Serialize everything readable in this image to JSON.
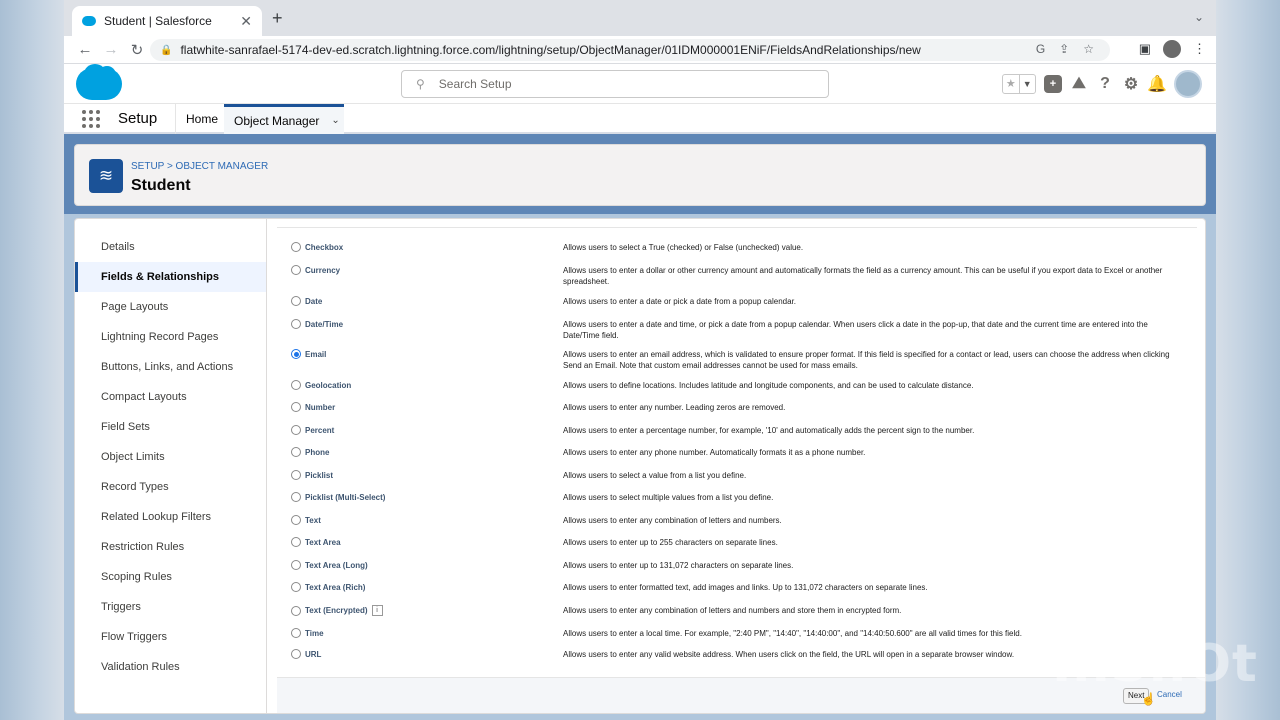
{
  "browser": {
    "tab_title": "Student | Salesforce",
    "tab_close": "✕",
    "new_tab": "+",
    "url": "flatwhite-sanrafael-5174-dev-ed.scratch.lightning.force.com/lightning/setup/ObjectManager/01IDM000001ENiF/FieldsAndRelationships/new"
  },
  "sf_header": {
    "search_placeholder": "Search Setup"
  },
  "setup_nav": {
    "app_name": "Setup",
    "home": "Home",
    "object_manager": "Object Manager"
  },
  "page_header": {
    "breadcrumb": "SETUP > OBJECT MANAGER",
    "title": "Student"
  },
  "sidebar": {
    "items": [
      {
        "label": "Details"
      },
      {
        "label": "Fields & Relationships",
        "active": true
      },
      {
        "label": "Page Layouts"
      },
      {
        "label": "Lightning Record Pages"
      },
      {
        "label": "Buttons, Links, and Actions"
      },
      {
        "label": "Compact Layouts"
      },
      {
        "label": "Field Sets"
      },
      {
        "label": "Object Limits"
      },
      {
        "label": "Record Types"
      },
      {
        "label": "Related Lookup Filters"
      },
      {
        "label": "Restriction Rules"
      },
      {
        "label": "Scoping Rules"
      },
      {
        "label": "Triggers"
      },
      {
        "label": "Flow Triggers"
      },
      {
        "label": "Validation Rules"
      }
    ]
  },
  "field_types": [
    {
      "name": "Checkbox",
      "description": "Allows users to select a True (checked) or False (unchecked) value."
    },
    {
      "name": "Currency",
      "description": "Allows users to enter a dollar or other currency amount and automatically formats the field as a currency amount. This can be useful if you export data to Excel or another spreadsheet."
    },
    {
      "name": "Date",
      "description": "Allows users to enter a date or pick a date from a popup calendar."
    },
    {
      "name": "Date/Time",
      "description": "Allows users to enter a date and time, or pick a date from a popup calendar. When users click a date in the pop-up, that date and the current time are entered into the Date/Time field."
    },
    {
      "name": "Email",
      "checked": true,
      "description": "Allows users to enter an email address, which is validated to ensure proper format. If this field is specified for a contact or lead, users can choose the address when clicking Send an Email. Note that custom email addresses cannot be used for mass emails."
    },
    {
      "name": "Geolocation",
      "description": "Allows users to define locations. Includes latitude and longitude components, and can be used to calculate distance."
    },
    {
      "name": "Number",
      "description": "Allows users to enter any number. Leading zeros are removed."
    },
    {
      "name": "Percent",
      "description": "Allows users to enter a percentage number, for example, '10' and automatically adds the percent sign to the number."
    },
    {
      "name": "Phone",
      "description": "Allows users to enter any phone number. Automatically formats it as a phone number."
    },
    {
      "name": "Picklist",
      "description": "Allows users to select a value from a list you define."
    },
    {
      "name": "Picklist (Multi-Select)",
      "description": "Allows users to select multiple values from a list you define."
    },
    {
      "name": "Text",
      "description": "Allows users to enter any combination of letters and numbers."
    },
    {
      "name": "Text Area",
      "description": "Allows users to enter up to 255 characters on separate lines."
    },
    {
      "name": "Text Area (Long)",
      "description": "Allows users to enter up to 131,072 characters on separate lines."
    },
    {
      "name": "Text Area (Rich)",
      "description": "Allows users to enter formatted text, add images and links. Up to 131,072 characters on separate lines."
    },
    {
      "name": "Text (Encrypted)",
      "info": "i",
      "description": "Allows users to enter any combination of letters and numbers and store them in encrypted form."
    },
    {
      "name": "Time",
      "description": "Allows users to enter a local time. For example, \"2:40 PM\", \"14:40\", \"14:40:00\", and \"14:40:50.600\" are all valid times for this field."
    },
    {
      "name": "URL",
      "description": "Allows users to enter any valid website address. When users click on the field, the URL will open in a separate browser window."
    }
  ],
  "footer": {
    "next": "Next",
    "cancel": "Cancel"
  },
  "watermark": "InShOt"
}
